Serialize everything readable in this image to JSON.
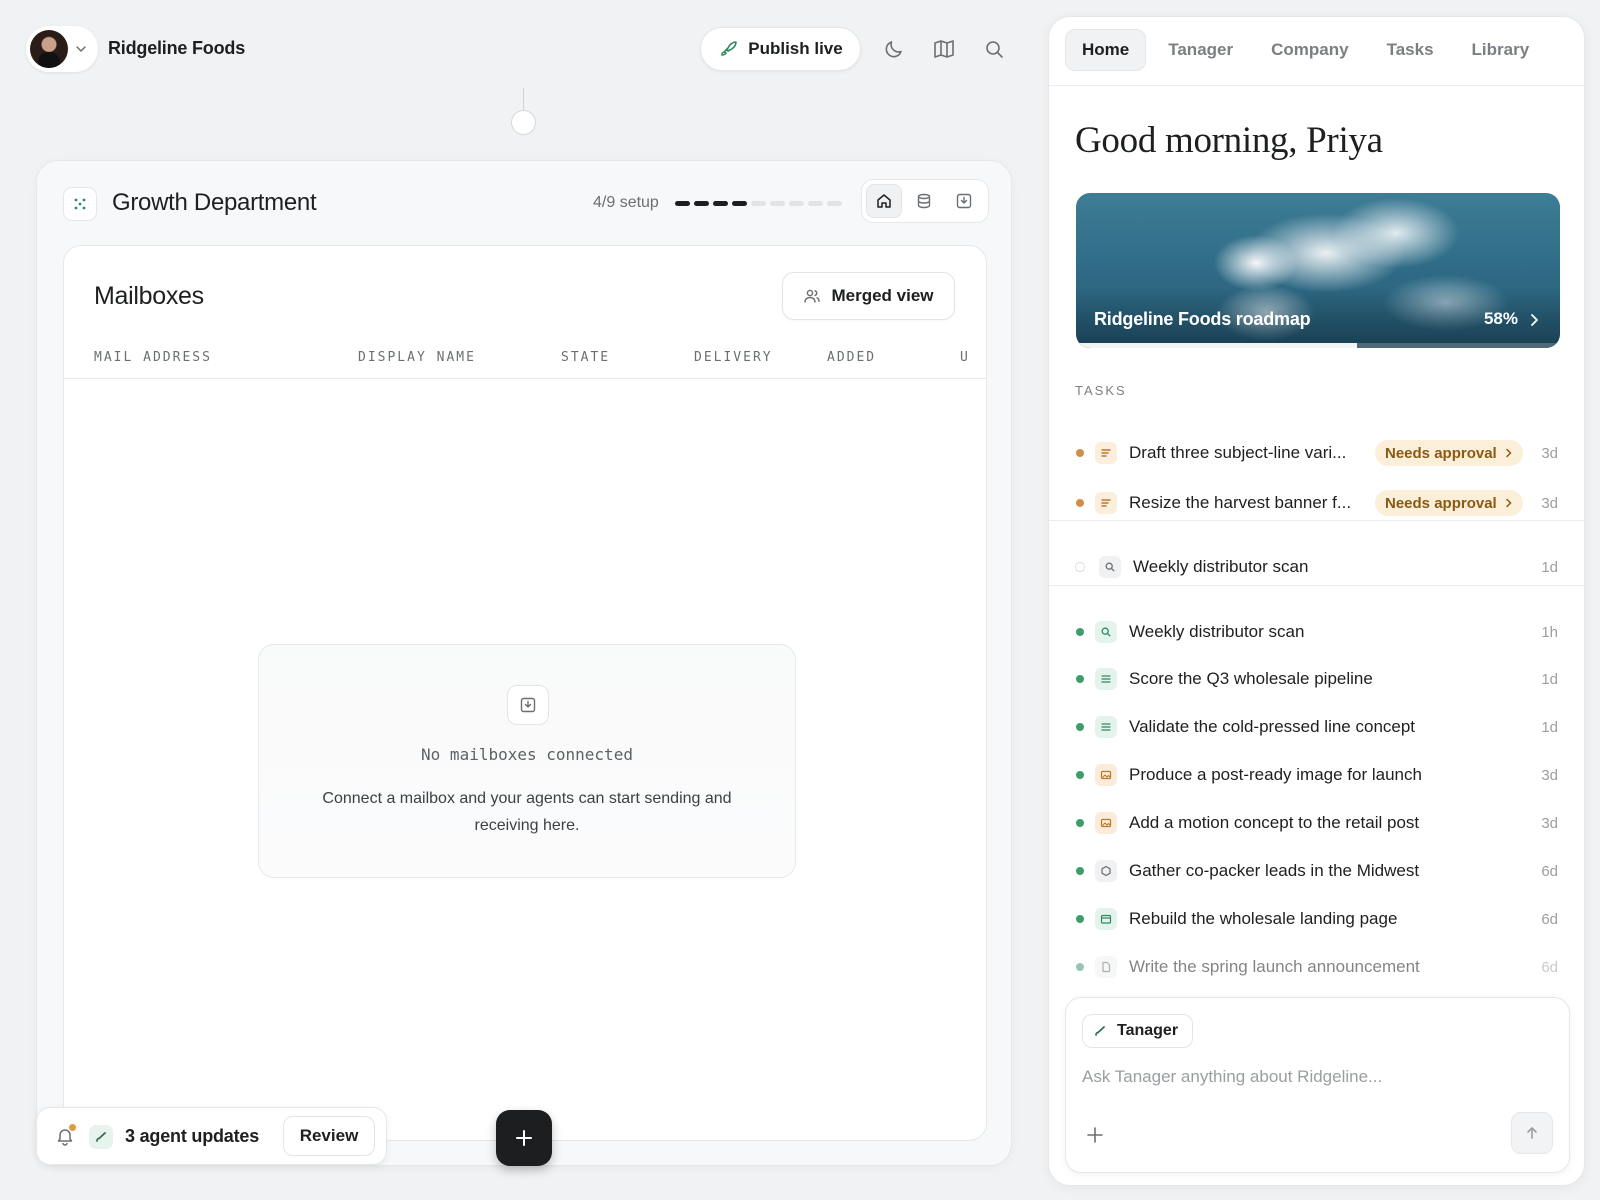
{
  "topbar": {
    "org_name": "Ridgeline Foods",
    "publish_label": "Publish live",
    "icons": [
      "moon-icon",
      "map-icon",
      "search-icon"
    ]
  },
  "department": {
    "title": "Growth Department",
    "setup_label": "4/9 setup",
    "setup_done": 4,
    "setup_total": 9
  },
  "mailboxes": {
    "title": "Mailboxes",
    "merged_view_label": "Merged view",
    "columns": [
      "MAIL ADDRESS",
      "DISPLAY NAME",
      "STATE",
      "DELIVERY",
      "ADDED",
      "U"
    ],
    "empty_title": "No mailboxes connected",
    "empty_desc": "Connect a mailbox and your agents can start sending and receiving here."
  },
  "updates": {
    "text": "3 agent updates",
    "review_label": "Review"
  },
  "right_panel": {
    "tabs": [
      "Home",
      "Tanager",
      "Company",
      "Tasks",
      "Library"
    ],
    "active_tab": "Home",
    "greeting": "Good morning, Priya",
    "roadmap": {
      "title": "Ridgeline Foods roadmap",
      "percent_label": "58%",
      "progress": 0.58
    },
    "tasks_label": "TASKS",
    "approval_tasks": [
      {
        "text": "Draft three subject-line vari...",
        "badge": "Needs approval",
        "time": "3d",
        "icon": "text-lines-icon"
      },
      {
        "text": "Resize the harvest banner f...",
        "badge": "Needs approval",
        "time": "3d",
        "icon": "text-lines-icon"
      }
    ],
    "pending_task": {
      "text": "Weekly distributor scan",
      "time": "1d",
      "icon": "search-icon"
    },
    "tasks": [
      {
        "text": "Weekly distributor scan",
        "time": "1h",
        "icon": "search-icon"
      },
      {
        "text": "Score the Q3 wholesale pipeline",
        "time": "1d",
        "icon": "text-lines-icon"
      },
      {
        "text": "Validate the cold-pressed line concept",
        "time": "1d",
        "icon": "text-lines-icon"
      },
      {
        "text": "Produce a post-ready image for launch",
        "time": "3d",
        "icon": "image-icon"
      },
      {
        "text": "Add a motion concept to the retail post",
        "time": "3d",
        "icon": "image-icon"
      },
      {
        "text": "Gather co-packer leads in the Midwest",
        "time": "6d",
        "icon": "hexagon-icon"
      },
      {
        "text": "Rebuild the wholesale landing page",
        "time": "6d",
        "icon": "browser-icon"
      },
      {
        "text": "Write the spring launch announcement",
        "time": "6d",
        "icon": "document-icon"
      }
    ],
    "composer": {
      "agent_label": "Tanager",
      "placeholder": "Ask Tanager anything about Ridgeline..."
    }
  },
  "colors": {
    "accent_green": "#3f9a6e",
    "accent_amber": "#cf8e45",
    "badge_bg": "#fbefd9",
    "badge_text": "#8a5a14",
    "fab": "#1c1e20"
  }
}
